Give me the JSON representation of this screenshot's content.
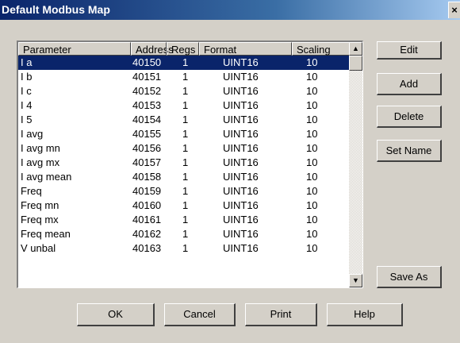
{
  "window": {
    "title": "Default Modbus Map",
    "close_label": "×"
  },
  "table": {
    "columns": [
      "Parameter",
      "Address",
      "Regs",
      "Format",
      "Scaling"
    ],
    "selected_index": 0,
    "rows": [
      [
        "I a",
        "40150",
        "1",
        "UINT16",
        "10"
      ],
      [
        "I b",
        "40151",
        "1",
        "UINT16",
        "10"
      ],
      [
        "I c",
        "40152",
        "1",
        "UINT16",
        "10"
      ],
      [
        "I 4",
        "40153",
        "1",
        "UINT16",
        "10"
      ],
      [
        "I 5",
        "40154",
        "1",
        "UINT16",
        "10"
      ],
      [
        "I avg",
        "40155",
        "1",
        "UINT16",
        "10"
      ],
      [
        "I avg mn",
        "40156",
        "1",
        "UINT16",
        "10"
      ],
      [
        "I avg mx",
        "40157",
        "1",
        "UINT16",
        "10"
      ],
      [
        "I avg mean",
        "40158",
        "1",
        "UINT16",
        "10"
      ],
      [
        "Freq",
        "40159",
        "1",
        "UINT16",
        "10"
      ],
      [
        "Freq mn",
        "40160",
        "1",
        "UINT16",
        "10"
      ],
      [
        "Freq mx",
        "40161",
        "1",
        "UINT16",
        "10"
      ],
      [
        "Freq mean",
        "40162",
        "1",
        "UINT16",
        "10"
      ],
      [
        "V unbal",
        "40163",
        "1",
        "UINT16",
        "10"
      ]
    ]
  },
  "scrollbar": {
    "up_icon": "arrow-up-icon",
    "down_icon": "arrow-down-icon"
  },
  "side_buttons": {
    "edit": "Edit",
    "add": "Add",
    "delete": "Delete",
    "set_name": "Set Name",
    "save_as": "Save As"
  },
  "bottom_buttons": {
    "ok": "OK",
    "cancel": "Cancel",
    "print": "Print",
    "help": "Help"
  }
}
